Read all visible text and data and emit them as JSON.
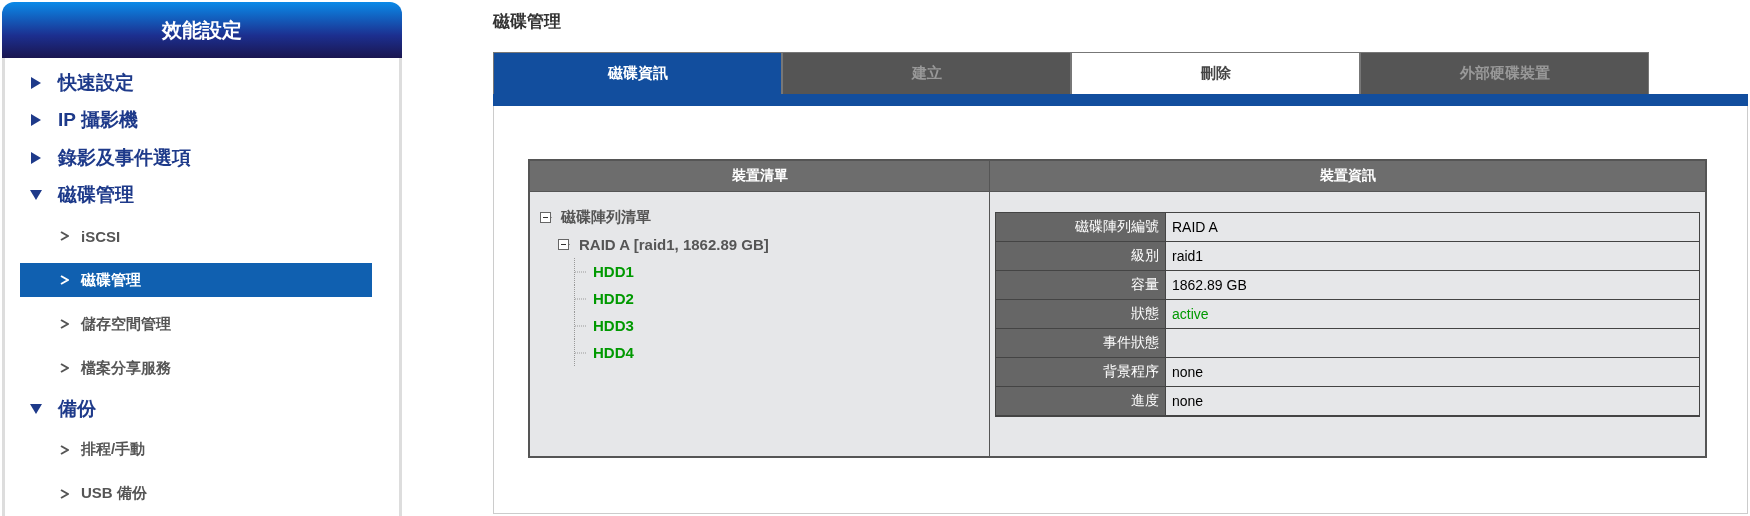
{
  "sidebar": {
    "title": "效能設定",
    "groups": [
      {
        "label": "快速設定",
        "expanded": false
      },
      {
        "label": "IP 攝影機",
        "expanded": false
      },
      {
        "label": "錄影及事件選項",
        "expanded": false
      },
      {
        "label": "磁碟管理",
        "expanded": true,
        "items": [
          {
            "label": "iSCSI",
            "selected": false
          },
          {
            "label": "磁碟管理",
            "selected": true
          },
          {
            "label": "儲存空間管理",
            "selected": false
          },
          {
            "label": "檔案分享服務",
            "selected": false
          }
        ]
      },
      {
        "label": "備份",
        "expanded": true,
        "items": [
          {
            "label": "排程/手動",
            "selected": false
          },
          {
            "label": "USB 備份",
            "selected": false
          }
        ]
      }
    ]
  },
  "page_title": "磁碟管理",
  "tabs": [
    {
      "label": "磁碟資訊",
      "selected": true,
      "disabled": false
    },
    {
      "label": "建立",
      "selected": false,
      "disabled": true
    },
    {
      "label": "刪除",
      "selected": false,
      "disabled": false
    },
    {
      "label": "外部硬碟裝置",
      "selected": false,
      "disabled": true
    }
  ],
  "device_list": {
    "heading": "裝置清單",
    "tree": [
      {
        "label": "磁碟陣列清單",
        "expanded": true,
        "color": "#555555",
        "children": [
          {
            "label": "RAID A [raid1, 1862.89 GB]",
            "expanded": true,
            "color": "#555555",
            "children": [
              {
                "label": "HDD1",
                "color": "#009900"
              },
              {
                "label": "HDD2",
                "color": "#009900"
              },
              {
                "label": "HDD3",
                "color": "#009900"
              },
              {
                "label": "HDD4",
                "color": "#009900"
              }
            ]
          }
        ]
      }
    ]
  },
  "device_info": {
    "heading": "裝置資訊",
    "rows": [
      {
        "label": "磁碟陣列編號",
        "value": "RAID A",
        "color": "#000000"
      },
      {
        "label": "級別",
        "value": "raid1",
        "color": "#000000"
      },
      {
        "label": "容量",
        "value": "1862.89 GB",
        "color": "#000000"
      },
      {
        "label": "狀態",
        "value": "active",
        "color": "#009900"
      },
      {
        "label": "事件狀態"
      },
      {
        "label": "背景程序",
        "value": "none",
        "color": "#000000"
      },
      {
        "label": "進度",
        "value": "none",
        "color": "#000000"
      }
    ]
  }
}
